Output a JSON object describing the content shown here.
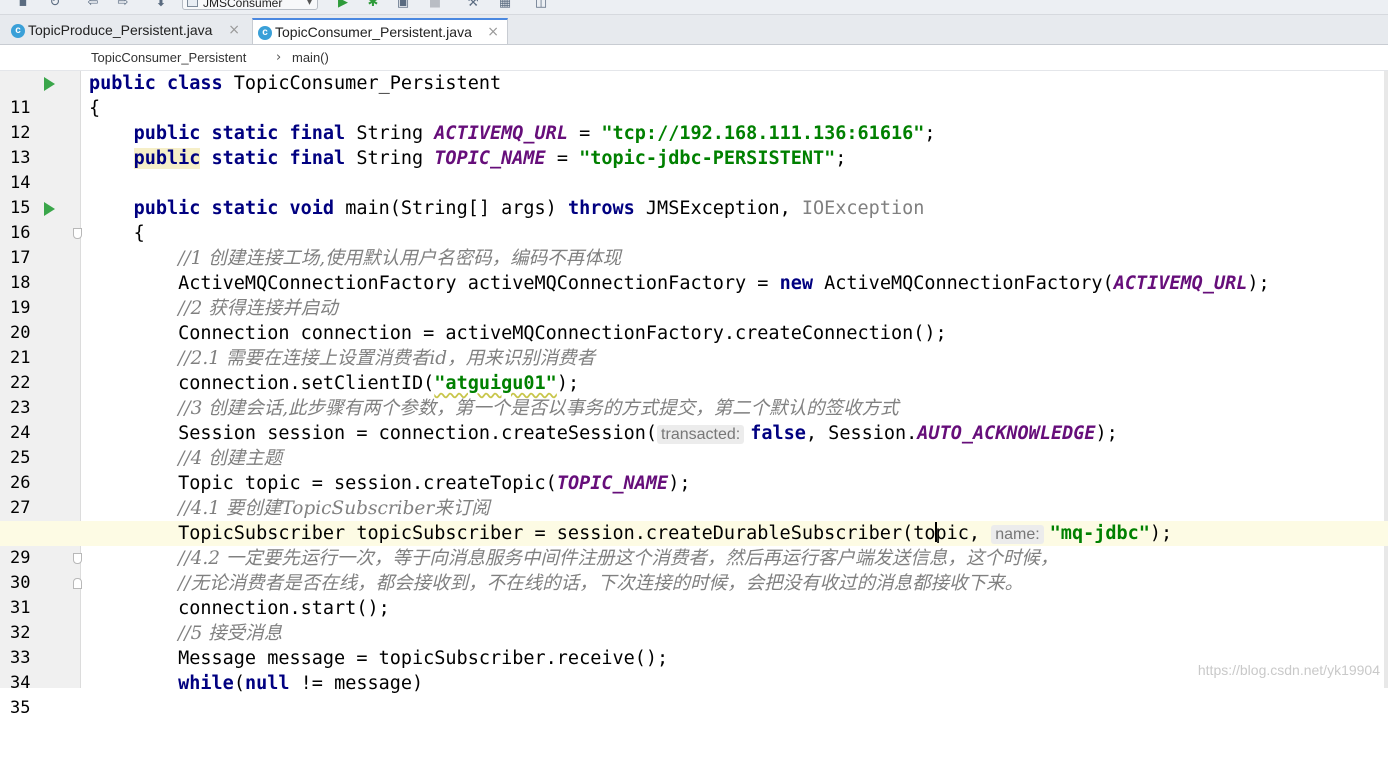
{
  "toolbar": {
    "run_config_label": "JMSConsumer"
  },
  "tabs": [
    {
      "label": "TopicProduce_Persistent.java",
      "active": false
    },
    {
      "label": "TopicConsumer_Persistent.java",
      "active": true
    }
  ],
  "tab_close_glyph": "×",
  "breadcrumb": {
    "items": [
      "TopicConsumer_Persistent",
      "main()"
    ],
    "separator": "›"
  },
  "editor": {
    "current_line": 29,
    "line_numbers": [
      "11",
      "12",
      "13",
      "14",
      "15",
      "16",
      "17",
      "18",
      "19",
      "20",
      "21",
      "22",
      "23",
      "24",
      "25",
      "26",
      "27",
      "28",
      "29",
      "30",
      "31",
      "32",
      "33",
      "34",
      "35"
    ],
    "lines": {
      "l11": [
        "public class ",
        "TopicConsumer_Persistent"
      ],
      "l12": [
        "{"
      ],
      "l13": [
        "public static final ",
        "String ",
        "ACTIVEMQ_URL",
        " = ",
        "\"tcp://192.168.111.136:61616\"",
        ";"
      ],
      "l14": [
        "public",
        " static final ",
        "String ",
        "TOPIC_NAME",
        " = ",
        "\"topic-jdbc-PERSISTENT\"",
        ";"
      ],
      "l16": [
        "public static void ",
        "main(String[] args) ",
        "throws ",
        "JMSException, ",
        "IOException"
      ],
      "l17": [
        "{"
      ],
      "l18": [
        "//1 创建连接工场,使用默认用户名密码，编码不再体现"
      ],
      "l19": [
        "ActiveMQConnectionFactory activeMQConnectionFactory = ",
        "new ",
        "ActiveMQConnectionFactory(",
        "ACTIVEMQ_URL",
        ");"
      ],
      "l20": [
        "//2 获得连接并启动"
      ],
      "l21": [
        "Connection connection = activeMQConnectionFactory.createConnection();"
      ],
      "l22": [
        "//2.1 需要在连接上设置消费者id，用来识别消费者"
      ],
      "l23": [
        "connection.setClientID(",
        "\"atguigu01\"",
        ");"
      ],
      "l24": [
        "//3 创建会话,此步骤有两个参数，第一个是否以事务的方式提交，第二个默认的签收方式"
      ],
      "l25": [
        "Session session = connection.createSession(",
        "transacted:",
        "false",
        ", Session.",
        "AUTO_ACKNOWLEDGE",
        ");"
      ],
      "l26": [
        "//4 创建主题"
      ],
      "l27": [
        "Topic topic = session.createTopic(",
        "TOPIC_NAME",
        ");"
      ],
      "l28": [
        "//4.1 要创建TopicSubscriber来订阅"
      ],
      "l29": [
        "TopicSubscriber topicSubscriber = session.createDurableSubscriber(to",
        "pic, ",
        "name:",
        "\"mq-jdbc\"",
        ");"
      ],
      "l30": [
        "//4.2 一定要先运行一次，等于向消息服务中间件注册这个消费者，然后再运行客户端发送信息，这个时候，"
      ],
      "l31": [
        "//无论消费者是否在线，都会接收到，不在线的话，下次连接的时候，会把没有收过的消息都接收下来。"
      ],
      "l32": [
        "connection.start();"
      ],
      "l33": [
        "//5 接受消息"
      ],
      "l34": [
        "Message message = topicSubscriber.receive();"
      ],
      "l35": [
        "while",
        "(",
        "null",
        " != message)"
      ]
    }
  },
  "watermark": "https://blog.csdn.net/yk19904",
  "colors": {
    "keyword": "#000080",
    "string": "#008000",
    "constant": "#660e7a",
    "comment": "#808080",
    "current_line_bg": "#fdfbe4",
    "run_gutter_icon": "#3aa64a"
  }
}
